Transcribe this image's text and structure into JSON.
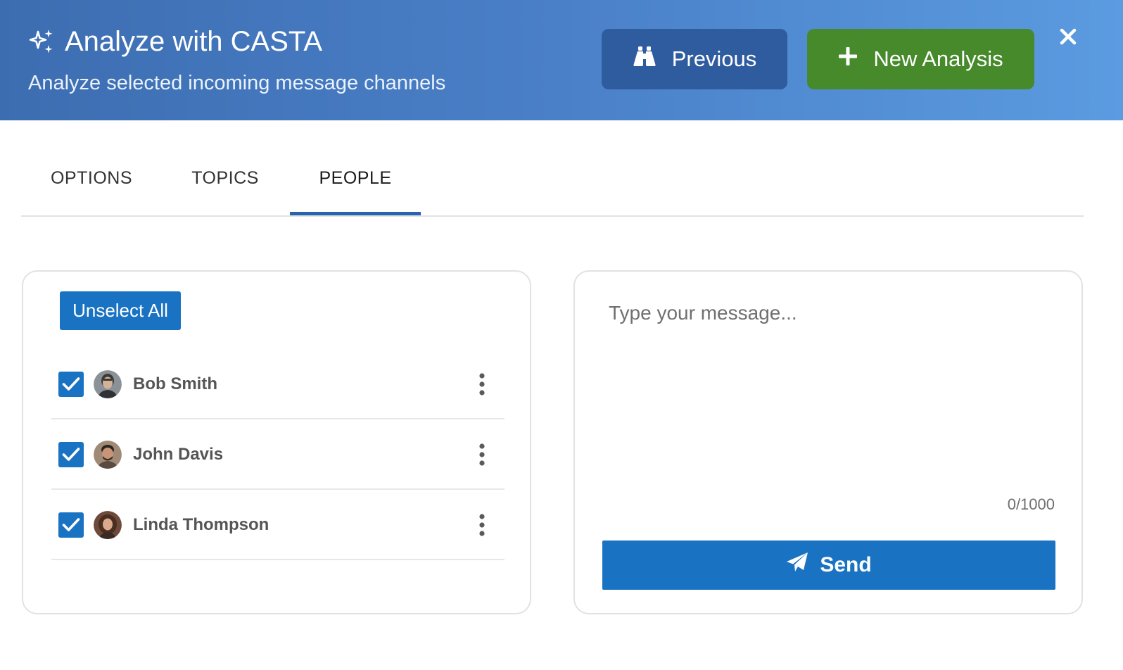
{
  "header": {
    "title": "Analyze with CASTA",
    "subtitle": "Analyze selected incoming message channels",
    "title_icon": "sparkle-icon",
    "previous_label": "Previous",
    "previous_icon": "binoculars-icon",
    "new_analysis_label": "New Analysis",
    "new_analysis_icon": "plus-icon",
    "close_icon": "close-icon"
  },
  "tabs": [
    {
      "label": "OPTIONS",
      "active": false
    },
    {
      "label": "TOPICS",
      "active": false
    },
    {
      "label": "PEOPLE",
      "active": true
    }
  ],
  "people_panel": {
    "unselect_all_label": "Unselect All",
    "people": [
      {
        "name": "Bob Smith",
        "checked": true
      },
      {
        "name": "John Davis",
        "checked": true
      },
      {
        "name": "Linda Thompson",
        "checked": true
      }
    ]
  },
  "message_panel": {
    "placeholder": "Type your message...",
    "value": "",
    "char_count": "0/1000",
    "send_label": "Send",
    "send_icon": "paper-plane-icon"
  },
  "colors": {
    "header_start": "#3d6db1",
    "header_end": "#5b9be0",
    "previous_button": "#2f5b9f",
    "new_analysis_button": "#468a2b",
    "primary": "#1a73c2",
    "active_tab_indicator": "#2a62b0"
  }
}
